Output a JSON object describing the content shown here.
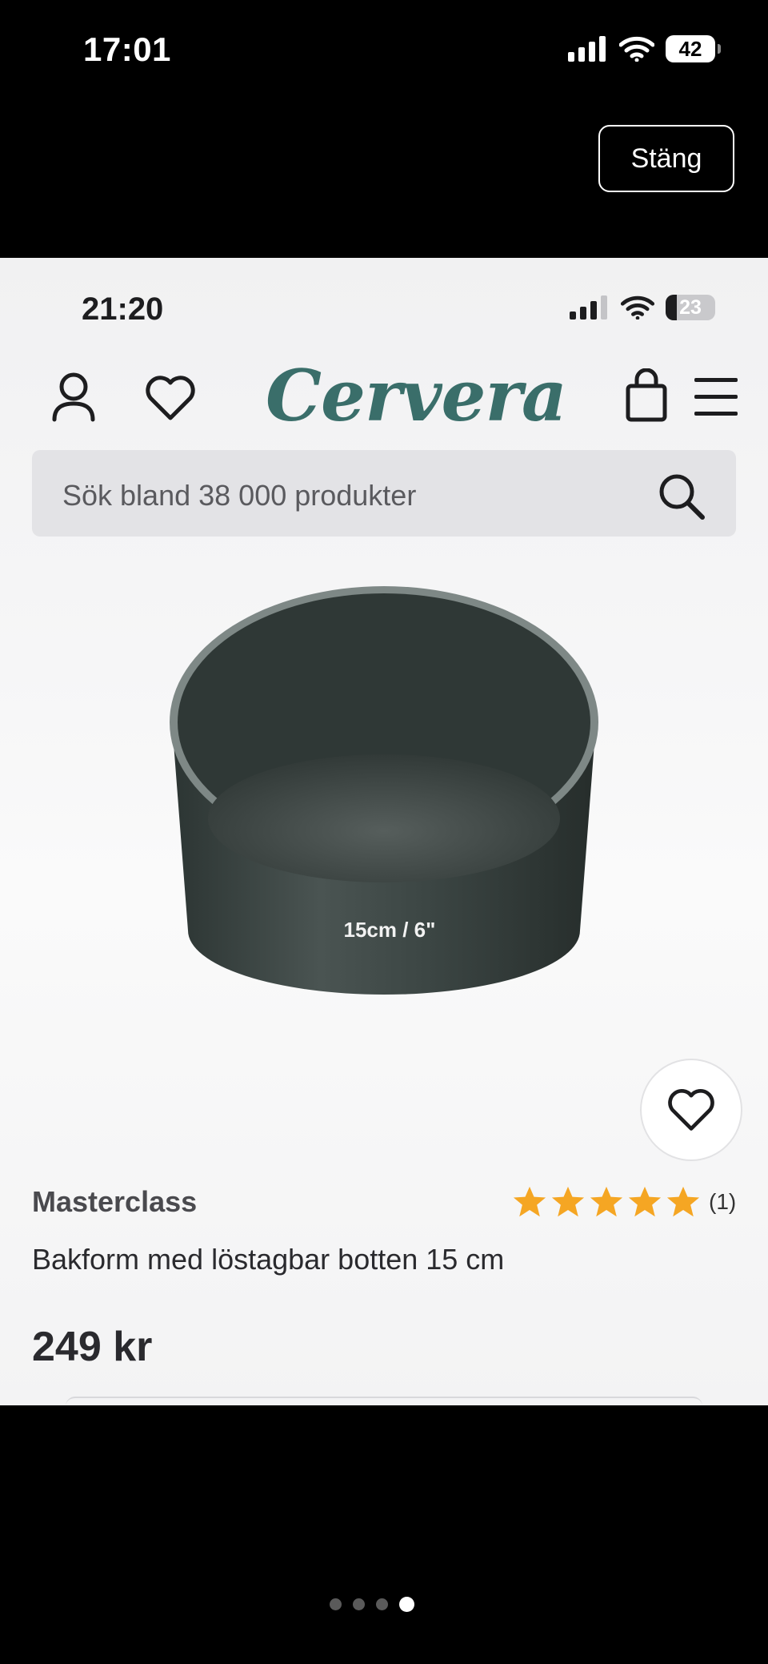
{
  "outer": {
    "time": "17:01",
    "battery": "42",
    "close_label": "Stäng"
  },
  "inner": {
    "time": "21:20",
    "battery": "23",
    "logo": "Cervera",
    "search": {
      "placeholder": "Sök bland 38 000 produkter"
    },
    "product": {
      "image_label": "15cm / 6\"",
      "brand": "Masterclass",
      "rating": {
        "stars": 5,
        "count": "(1)"
      },
      "name": "Bakform med löstagbar botten 15 cm",
      "price": "249 kr"
    }
  },
  "pager": {
    "count": 4,
    "active_index": 3
  },
  "colors": {
    "brand_teal": "#3a6e6a",
    "star": "#f5a623"
  }
}
